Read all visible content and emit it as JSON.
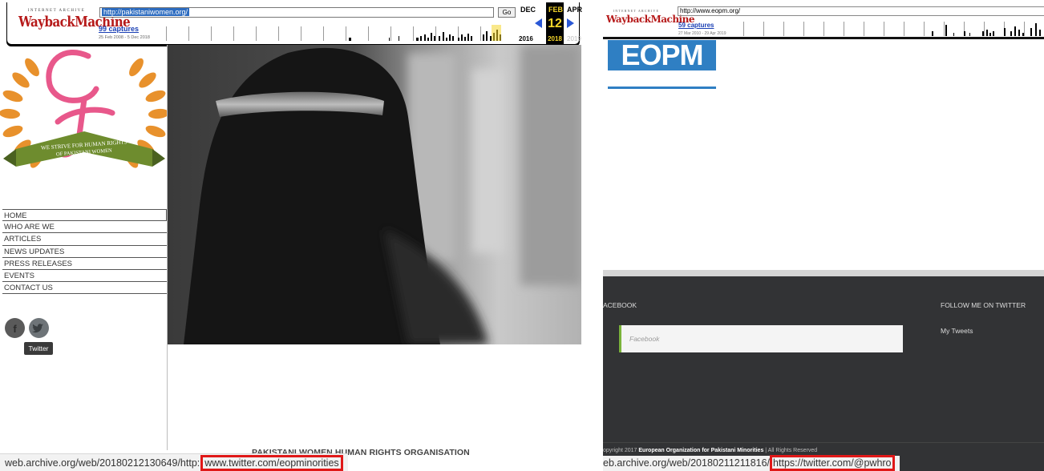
{
  "left": {
    "wayback": {
      "brand_top": "INTERNET ARCHIVE",
      "brand_main": "WaybackMachine",
      "url": "http://pakistaniwomen.org/",
      "go_label": "Go",
      "captures": "99 captures",
      "capture_range": "25 Feb 2008 - 5 Dec 2018",
      "prev_month": "DEC",
      "cur_month": "FEB",
      "next_month": "APR",
      "day": "12",
      "prev_year": "2016",
      "cur_year": "2018",
      "next_year": "2019"
    },
    "logo_text_1": "WE STRIVE FOR HUMAN RIGHTS",
    "logo_text_2": "OF PAKISTANI WOMEN",
    "menu": [
      "HOME",
      "WHO ARE WE",
      "ARTICLES",
      "NEWS UPDATES",
      "PRESS RELEASES",
      "EVENTS",
      "CONTACT US"
    ],
    "tooltip": "Twitter",
    "org_name": "PAKISTANI WOMEN HUMAN RIGHTS ORGANISATION",
    "status_prefix": "web.archive.org/web/20180212130649/http:",
    "status_link": "www.twitter.com/eopminorities"
  },
  "right": {
    "wayback": {
      "brand_top": "INTERNET ARCHIVE",
      "brand_main": "WaybackMachine",
      "url": "http://www.eopm.org/",
      "captures": "59 captures",
      "capture_range": "27 Mar 2010 - 29 Apr 2019"
    },
    "logo": "EOPM",
    "facebook_heading": "ACEBOOK",
    "facebook_placeholder": "Facebook",
    "twitter_heading": "FOLLOW ME ON TWITTER",
    "my_tweets": "My Tweets",
    "copyright_prefix": "opyright 2017",
    "copyright_org": "European Organization for Pakistani Minorities",
    "copyright_suffix": "|   All Rights Reserved",
    "status_prefix": "eb.archive.org/web/20180211211816/",
    "status_link": "https://twitter.com/@pwhro"
  },
  "colors": {
    "highlight": "#e01818",
    "wayback_red": "#b61a1a",
    "eopm_blue": "#2f7fc3",
    "footer_dark": "#323335",
    "fb_accent": "#7ab33a"
  }
}
